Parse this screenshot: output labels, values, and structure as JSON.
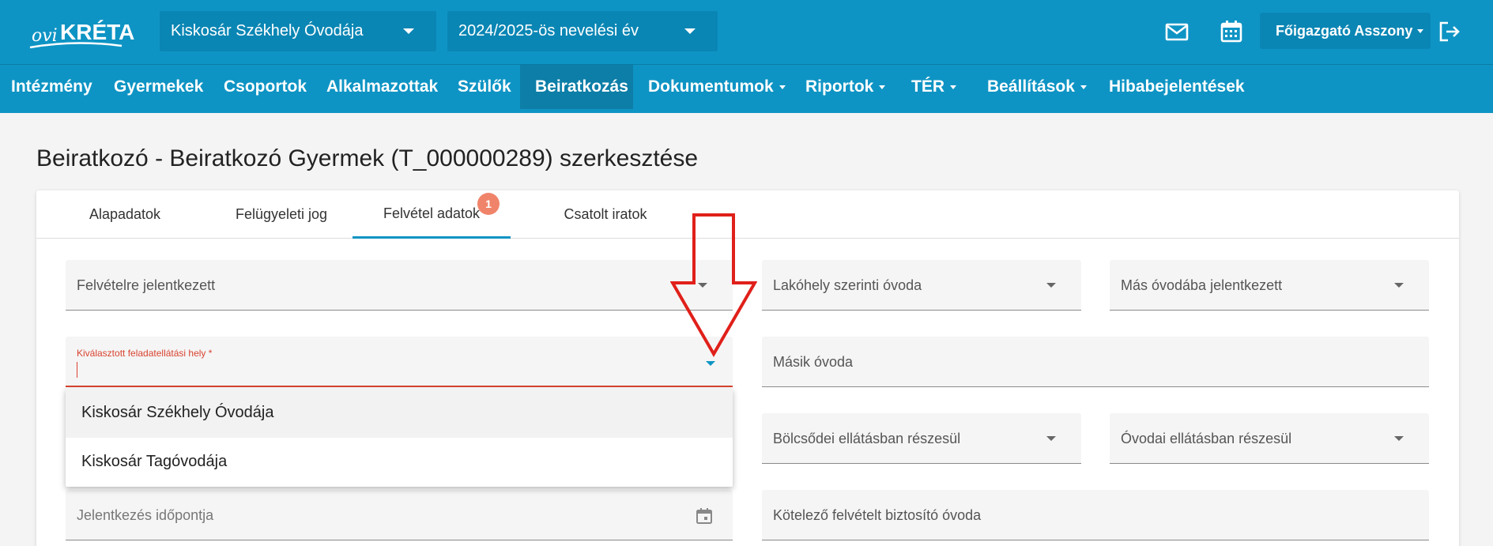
{
  "header": {
    "logo_text": "oviKRÉTA",
    "institution_select": "Kiskosár Székhely Óvodája",
    "year_select": "2024/2025-ös nevelési év",
    "user_menu": "Főigazgató Asszony",
    "icons": [
      "mail-icon",
      "calendar-icon",
      "logout-icon"
    ],
    "bg_color": "#0e94c4"
  },
  "nav": {
    "items": [
      {
        "label": "Intézmény"
      },
      {
        "label": "Gyermekek"
      },
      {
        "label": "Csoportok"
      },
      {
        "label": "Alkalmazottak"
      },
      {
        "label": "Szülők"
      },
      {
        "label": "Beiratkozás",
        "active": true
      },
      {
        "label": "Dokumentumok",
        "dropdown": true
      },
      {
        "label": "Riportok",
        "dropdown": true
      },
      {
        "label": "TÉR",
        "dropdown": true
      },
      {
        "label": "Beállítások",
        "dropdown": true
      },
      {
        "label": "Hibabejelentések"
      }
    ]
  },
  "page": {
    "title": "Beiratkozó - Beiratkozó Gyermek (T_000000289) szerkesztése"
  },
  "tabs": [
    {
      "label": "Alapadatok"
    },
    {
      "label": "Felügyeleti jog"
    },
    {
      "label": "Felvétel adatok",
      "active": true,
      "badge": "1"
    },
    {
      "label": "Csatolt iratok"
    }
  ],
  "form": {
    "felvetelre_jelentkezett": "Felvételre jelentkezett",
    "lakohely_szerinti_ovoda": "Lakóhely szerinti óvoda",
    "mas_ovodaba_jelentkezett": "Más óvodába jelentkezett",
    "kivalasztott_label": "Kiválasztott feladatellátási hely *",
    "masik_ovoda": "Másik óvoda",
    "bolcsodei": "Bölcsődei ellátásban részesül",
    "ovodai": "Óvodai ellátásban részesül",
    "jelentkezes_idopontja": "Jelentkezés időpontja",
    "kotelezo": "Kötelező felvételt biztosító óvoda"
  },
  "dropdown_options": [
    "Kiskosár Székhely Óvodája",
    "Kiskosár Tagóvodája"
  ],
  "colors": {
    "accent": "#0e94c4",
    "error": "#d9432f",
    "badge": "#f0846b",
    "annotation_arrow": "#e0201a"
  }
}
